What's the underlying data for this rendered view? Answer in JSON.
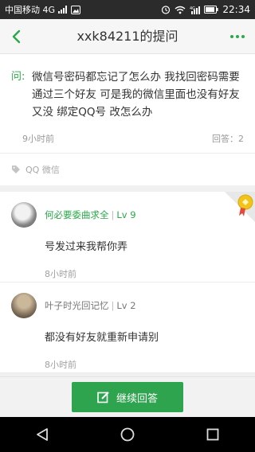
{
  "status_bar": {
    "carrier": "中国移动 4G",
    "time": "22:34",
    "icons": [
      "signal-icon",
      "gallery-icon",
      "alarm-icon",
      "wifi-icon",
      "network-4g-icon",
      "battery-icon"
    ]
  },
  "header": {
    "title": "xxk84211的提问"
  },
  "question": {
    "prefix": "问:",
    "text": "微信号密码都忘记了怎么办   我找回密码需要通过三个好友  可是我的微信里面也没有好友   又没 绑定QQ号   改怎么办",
    "time": "9小时前",
    "answer_count": "回答：2"
  },
  "tags": {
    "text": "QQ 微信"
  },
  "answers": [
    {
      "author": "何必要委曲求全",
      "level": "Lv 9",
      "text": "号发过来我帮你弄",
      "time": "8小时前"
    },
    {
      "author": "叶子时光回记忆",
      "level": "Lv 2",
      "text": "都没有好友就重新申请别",
      "time": "8小时前"
    }
  ],
  "bottom": {
    "continue_label": "继续回答"
  },
  "colors": {
    "accent": "#2aa84a",
    "button": "#2ea44f",
    "statusbar": "#2b2b2b",
    "navbar": "#000000"
  }
}
